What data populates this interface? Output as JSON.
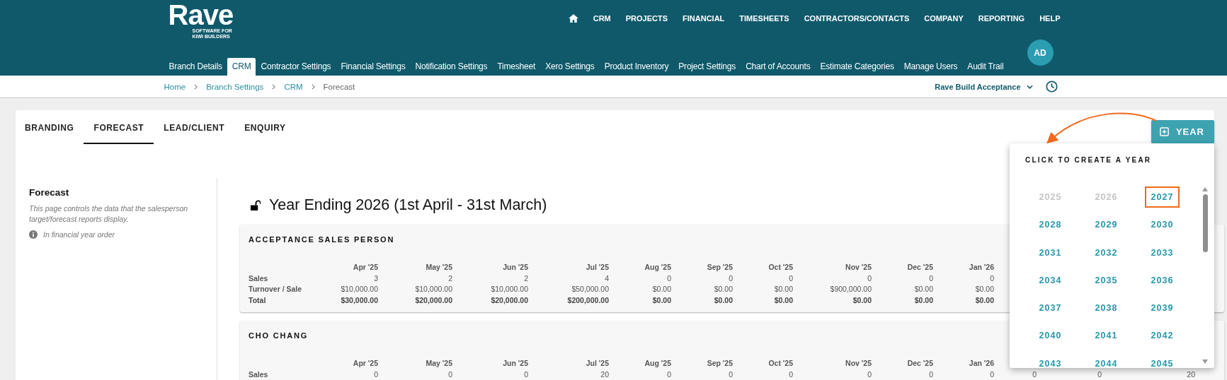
{
  "header": {
    "logo": {
      "name": "Rave",
      "tagline": "SOFTWARE FOR KIWI BUILDERS"
    },
    "nav": [
      "CRM",
      "PROJECTS",
      "FINANCIAL",
      "TIMESHEETS",
      "CONTRACTORS/CONTACTS",
      "COMPANY",
      "REPORTING",
      "HELP"
    ],
    "settings_tabs": [
      {
        "label": "Branch Details",
        "selected": false
      },
      {
        "label": "CRM",
        "selected": true
      },
      {
        "label": "Contractor Settings",
        "selected": false
      },
      {
        "label": "Financial Settings",
        "selected": false
      },
      {
        "label": "Notification Settings",
        "selected": false
      },
      {
        "label": "Timesheet",
        "selected": false
      },
      {
        "label": "Xero Settings",
        "selected": false
      },
      {
        "label": "Product Inventory",
        "selected": false
      },
      {
        "label": "Project Settings",
        "selected": false
      },
      {
        "label": "Chart of Accounts",
        "selected": false
      },
      {
        "label": "Estimate Categories",
        "selected": false
      },
      {
        "label": "Manage Users",
        "selected": false
      },
      {
        "label": "Audit Trail",
        "selected": false
      }
    ],
    "avatar": "AD"
  },
  "breadcrumb": [
    "Home",
    "Branch Settings",
    "CRM",
    "Forecast"
  ],
  "company_selector": "Rave Build Acceptance",
  "tabs": [
    {
      "label": "BRANDING",
      "selected": false
    },
    {
      "label": "FORECAST",
      "selected": true
    },
    {
      "label": "LEAD/CLIENT",
      "selected": false
    },
    {
      "label": "ENQUIRY",
      "selected": false
    }
  ],
  "year_button": "YEAR",
  "sidebar": {
    "title": "Forecast",
    "description": "This page controls the data that the salesperson target/forecast reports display.",
    "note": "In financial year order"
  },
  "year_title": {
    "text": "Year Ending 2026 (1st April - 31st March)",
    "locked": false
  },
  "forecasts": [
    {
      "name": "ACCEPTANCE SALES PERSON",
      "columns": [
        "Apr '25",
        "May '25",
        "Jun '25",
        "Jul '25",
        "Aug '25",
        "Sep '25",
        "Oct '25",
        "Nov '25",
        "Dec '25",
        "Jan '26"
      ],
      "rows": [
        {
          "label": "Sales",
          "kind": "data",
          "cells": [
            "3",
            "2",
            "2",
            "4",
            "0",
            "0",
            "0",
            "0",
            "0",
            "0"
          ]
        },
        {
          "label": "Turnover / Sale",
          "kind": "data",
          "cells": [
            "$10,000.00",
            "$10,000.00",
            "$10,000.00",
            "$50,000.00",
            "$0.00",
            "$0.00",
            "$0.00",
            "$900,000.00",
            "$0.00",
            "$0.00"
          ]
        },
        {
          "label": "Total",
          "kind": "total",
          "cells": [
            "$30,000.00",
            "$20,000.00",
            "$20,000.00",
            "$200,000.00",
            "$0.00",
            "$0.00",
            "$0.00",
            "$0.00",
            "$0.00",
            "$0.00"
          ]
        }
      ]
    },
    {
      "name": "CHO CHANG",
      "columns": [
        "Apr '25",
        "May '25",
        "Jun '25",
        "Jul '25",
        "Aug '25",
        "Sep '25",
        "Oct '25",
        "Nov '25",
        "Dec '25",
        "Jan '26"
      ],
      "rows": [
        {
          "label": "Sales",
          "kind": "data",
          "cells": [
            "0",
            "0",
            "0",
            "20",
            "0",
            "0",
            "0",
            "0",
            "0",
            "0",
            "0",
            "0",
            "20"
          ]
        }
      ]
    }
  ],
  "year_popup": {
    "title": "CLICK TO CREATE A YEAR",
    "years": [
      {
        "label": "2025",
        "disabled": true,
        "highlighted": false
      },
      {
        "label": "2026",
        "disabled": true,
        "highlighted": false
      },
      {
        "label": "2027",
        "disabled": false,
        "highlighted": true
      },
      {
        "label": "2028",
        "disabled": false,
        "highlighted": false
      },
      {
        "label": "2029",
        "disabled": false,
        "highlighted": false
      },
      {
        "label": "2030",
        "disabled": false,
        "highlighted": false
      },
      {
        "label": "2031",
        "disabled": false,
        "highlighted": false
      },
      {
        "label": "2032",
        "disabled": false,
        "highlighted": false
      },
      {
        "label": "2033",
        "disabled": false,
        "highlighted": false
      },
      {
        "label": "2034",
        "disabled": false,
        "highlighted": false
      },
      {
        "label": "2035",
        "disabled": false,
        "highlighted": false
      },
      {
        "label": "2036",
        "disabled": false,
        "highlighted": false
      },
      {
        "label": "2037",
        "disabled": false,
        "highlighted": false
      },
      {
        "label": "2038",
        "disabled": false,
        "highlighted": false
      },
      {
        "label": "2039",
        "disabled": false,
        "highlighted": false
      },
      {
        "label": "2040",
        "disabled": false,
        "highlighted": false
      },
      {
        "label": "2041",
        "disabled": false,
        "highlighted": false
      },
      {
        "label": "2042",
        "disabled": false,
        "highlighted": false
      },
      {
        "label": "2043",
        "disabled": false,
        "highlighted": false
      },
      {
        "label": "2044",
        "disabled": false,
        "highlighted": false
      },
      {
        "label": "2045",
        "disabled": false,
        "highlighted": false
      }
    ]
  }
}
